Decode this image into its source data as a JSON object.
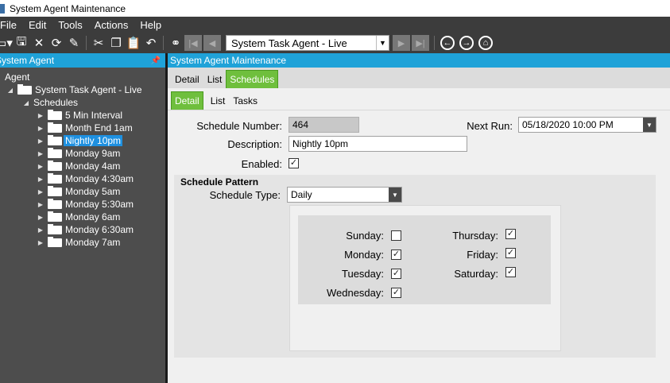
{
  "window": {
    "title": "System Agent Maintenance"
  },
  "menu": [
    "File",
    "Edit",
    "Tools",
    "Actions",
    "Help"
  ],
  "toolbar": {
    "agent_selected": "System Task Agent - Live"
  },
  "sidebar": {
    "header": "System Agent",
    "root": "Agent",
    "agent": "System Task Agent - Live",
    "schedules_label": "Schedules",
    "items": [
      "5 Min Interval",
      "Month End 1am",
      "Nightly 10pm",
      "Monday 9am",
      "Monday 4am",
      "Monday 4:30am",
      "Monday 5am",
      "Monday 5:30am",
      "Monday 6am",
      "Monday 6:30am",
      "Monday 7am"
    ],
    "selected": "Nightly 10pm"
  },
  "main": {
    "header": "System Agent Maintenance",
    "tabs_top": [
      "Detail",
      "List",
      "Schedules"
    ],
    "tabs_top_active": "Schedules",
    "tabs_sub": [
      "Detail",
      "List",
      "Tasks"
    ],
    "tabs_sub_active": "Detail",
    "form": {
      "schedule_number_label": "Schedule Number:",
      "schedule_number": "464",
      "next_run_label": "Next Run:",
      "next_run": "05/18/2020 10:00 PM",
      "description_label": "Description:",
      "description": "Nightly 10pm",
      "enabled_label": "Enabled:",
      "enabled": true
    },
    "pattern": {
      "title": "Schedule Pattern",
      "type_label": "Schedule Type:",
      "type": "Daily",
      "days": {
        "sunday": {
          "label": "Sunday:",
          "checked": false
        },
        "monday": {
          "label": "Monday:",
          "checked": true
        },
        "tuesday": {
          "label": "Tuesday:",
          "checked": true
        },
        "wednesday": {
          "label": "Wednesday:",
          "checked": true
        },
        "thursday": {
          "label": "Thursday:",
          "checked": true
        },
        "friday": {
          "label": "Friday:",
          "checked": true
        },
        "saturday": {
          "label": "Saturday:",
          "checked": true
        }
      }
    }
  }
}
